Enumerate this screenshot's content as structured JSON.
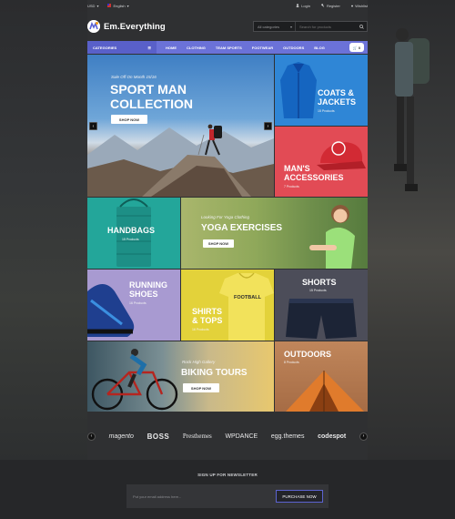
{
  "topbar": {
    "currency": "USD",
    "language": "English",
    "login": "Login",
    "register": "Register",
    "wishlist": "Wishlist"
  },
  "header": {
    "logo_text": "Em.Everything",
    "search_category": "All categories",
    "search_placeholder": "Search for products"
  },
  "nav": {
    "categories_label": "CATEGORIES",
    "items": [
      "HOME",
      "CLOTHING",
      "TEAM SPORTS",
      "FOOTWEAR",
      "OUTDOORS",
      "BLOG"
    ],
    "cart_count": "0"
  },
  "hero": {
    "kicker": "Sale Off On Month 15/16",
    "title_line1": "SPORT MAN",
    "title_line2": "COLLECTION",
    "button": "SHOP NOW"
  },
  "tiles": {
    "coats_title1": "COATS &",
    "coats_title2": "JACKETS",
    "coats_sub": "15 Products",
    "accessories_title1": "MAN'S",
    "accessories_title2": "ACCESSORIES",
    "accessories_sub": "7 Products",
    "handbags_title": "HANDBAGS",
    "handbags_sub": "15 Products",
    "yoga_kicker": "Looking For Yoga Clothing",
    "yoga_title": "YOGA EXERCISES",
    "yoga_button": "SHOP NOW",
    "running_title1": "RUNNING",
    "running_title2": "SHOES",
    "running_sub": "16 Products",
    "shirts_title1": "SHIRTS",
    "shirts_title2": "& TOPS",
    "shirts_sub": "16 Products",
    "shirt_print": "FOOTBALL",
    "shorts_title": "SHORTS",
    "shorts_sub": "15 Products",
    "biking_kicker": "Rock High Gallery",
    "biking_title": "BIKING TOURS",
    "biking_button": "SHOP NOW",
    "outdoors_title": "OUTDOORS",
    "outdoors_sub": "8 Products"
  },
  "brands": [
    "magento",
    "BOSS",
    "Presthemes",
    "WPDANCE",
    "egg.themes",
    "codespot"
  ],
  "newsletter": {
    "title": "SIGN UP FOR NEWSLETTER",
    "placeholder": "Put your email address here...",
    "button": "PURCHASE NOW"
  },
  "colors": {
    "accent": "#6b72d8",
    "coats_bg": "#2f86d6",
    "accessories_bg": "#e24b55",
    "handbags_bg": "#23a69a",
    "running_bg": "#a89ad1",
    "shirts_bg": "#e3d23a",
    "shorts_bg": "#4c4d59",
    "outdoors_bg": "#b77951"
  }
}
